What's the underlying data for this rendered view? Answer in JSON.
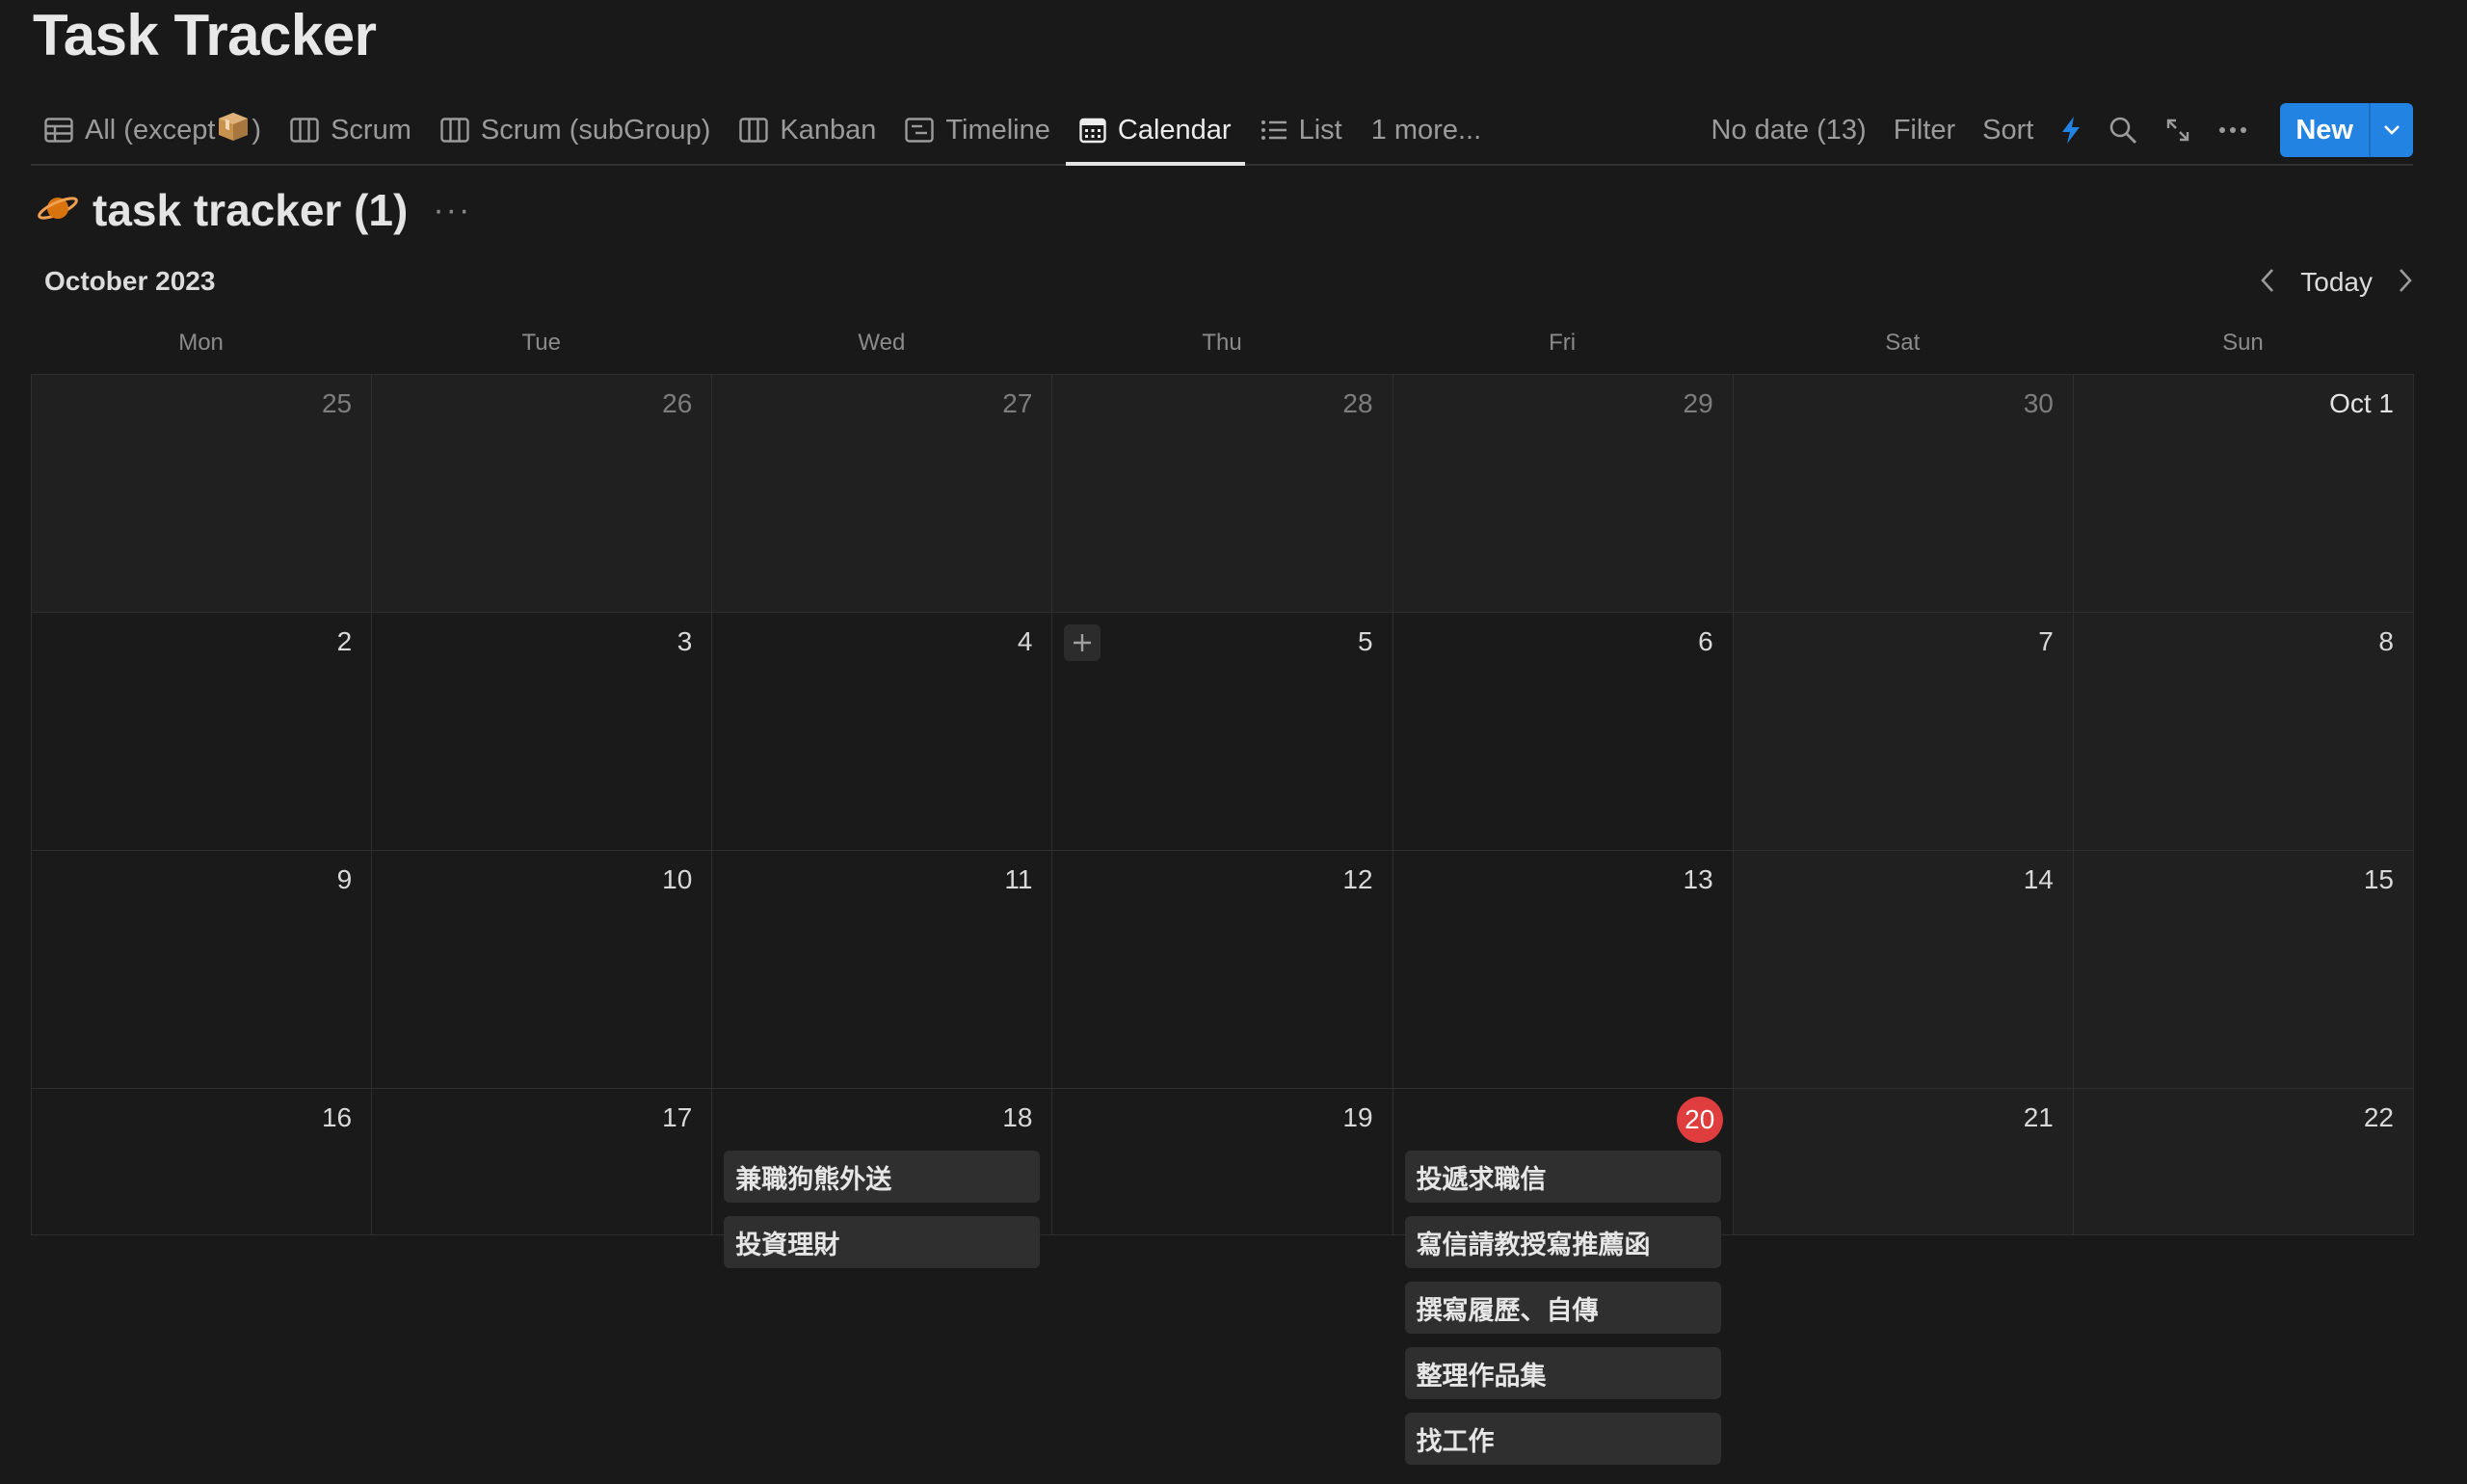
{
  "page": {
    "title": "Task Tracker"
  },
  "tabs": [
    {
      "label": "All (except",
      "suffix": ")",
      "icon": "table-icon"
    },
    {
      "label": "Scrum",
      "icon": "board-icon"
    },
    {
      "label": "Scrum (subGroup)",
      "icon": "board-icon"
    },
    {
      "label": "Kanban",
      "icon": "board-icon"
    },
    {
      "label": "Timeline",
      "icon": "timeline-icon"
    },
    {
      "label": "Calendar",
      "icon": "calendar-icon",
      "active": true
    },
    {
      "label": "List",
      "icon": "list-icon"
    },
    {
      "label": "1 more..."
    }
  ],
  "toolbar": {
    "no_date": "No date (13)",
    "filter": "Filter",
    "sort": "Sort",
    "new_label": "New",
    "accent": "#2383e2"
  },
  "database": {
    "name": "task tracker (1)",
    "dots": "···",
    "icon": "planet-icon"
  },
  "calendar": {
    "month": "October 2023",
    "today_label": "Today",
    "weekdays": [
      "Mon",
      "Tue",
      "Wed",
      "Thu",
      "Fri",
      "Sat",
      "Sun"
    ],
    "weeks": [
      [
        "25",
        "26",
        "27",
        "28",
        "29",
        "30",
        "Oct 1"
      ],
      [
        "2",
        "3",
        "4",
        "5",
        "6",
        "7",
        "8"
      ],
      [
        "9",
        "10",
        "11",
        "12",
        "13",
        "14",
        "15"
      ],
      [
        "16",
        "17",
        "18",
        "19",
        "20",
        "21",
        "22"
      ]
    ],
    "today_day": "20",
    "today_color": "#e03e3e",
    "events": {
      "day18": [
        "兼職狗熊外送",
        "投資理財"
      ],
      "day20": [
        "投遞求職信",
        "寫信請教授寫推薦函",
        "撰寫履歷、自傳",
        "整理作品集",
        "找工作"
      ]
    }
  }
}
